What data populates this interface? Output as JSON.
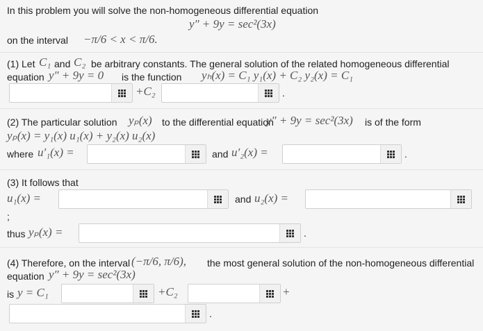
{
  "intro": {
    "text": "In this problem you will solve the non-homogeneous differential equation",
    "equation": "y″ + 9y = sec²(3x)",
    "interval_prefix": "on the interval",
    "interval": "−π/6 < x < π/6."
  },
  "part1": {
    "line1_a": "(1) Let",
    "c1": "C₁",
    "and": "and",
    "c2": "C₂",
    "line1_b": "be arbitrary constants. The general solution of the related homogeneous differential",
    "line2_a": "equation",
    "hom_eq": "y″ + 9y = 0",
    "line2_b": "is the function",
    "yh": "yₕ(x) = C₁ y₁(x) + C₂ y₂(x) = C₁",
    "plus_c2": "+C₂",
    "period": "."
  },
  "part2": {
    "line1_a": "(2) The particular solution",
    "yp": "yₚ(x)",
    "line1_b": "to the differential equation",
    "eq": "y″ + 9y = sec²(3x)",
    "line1_c": "is of the form",
    "form": "yₚ(x) = y₁(x) u₁(x) + y₂(x) u₂(x)",
    "where": "where",
    "u1p": "u′₁(x) =",
    "and": "and",
    "u2p": "u′₂(x) =",
    "period": "."
  },
  "part3": {
    "intro": "(3) It follows that",
    "u1": "u₁(x) =",
    "and": "and",
    "u2": "u₂(x) =",
    "semicolon": ";",
    "thus": "thus",
    "yp": "yₚ(x) =",
    "period": "."
  },
  "part4": {
    "line1_a": "(4) Therefore, on the interval",
    "interval": "(−π/6, π/6),",
    "line1_b": "the most general solution of the non-homogeneous differential",
    "line2_a": "equation",
    "eq": "y″ + 9y = sec²(3x)",
    "is": "is",
    "y_c1": "y = C₁",
    "plus_c2": "+C₂",
    "plus": "+",
    "period": "."
  },
  "fields": {
    "yh_c1": "",
    "yh_c2": "",
    "u1p": "",
    "u2p": "",
    "u1": "",
    "u2": "",
    "yp": "",
    "gen_c1": "",
    "gen_c2": "",
    "gen_rest": ""
  }
}
